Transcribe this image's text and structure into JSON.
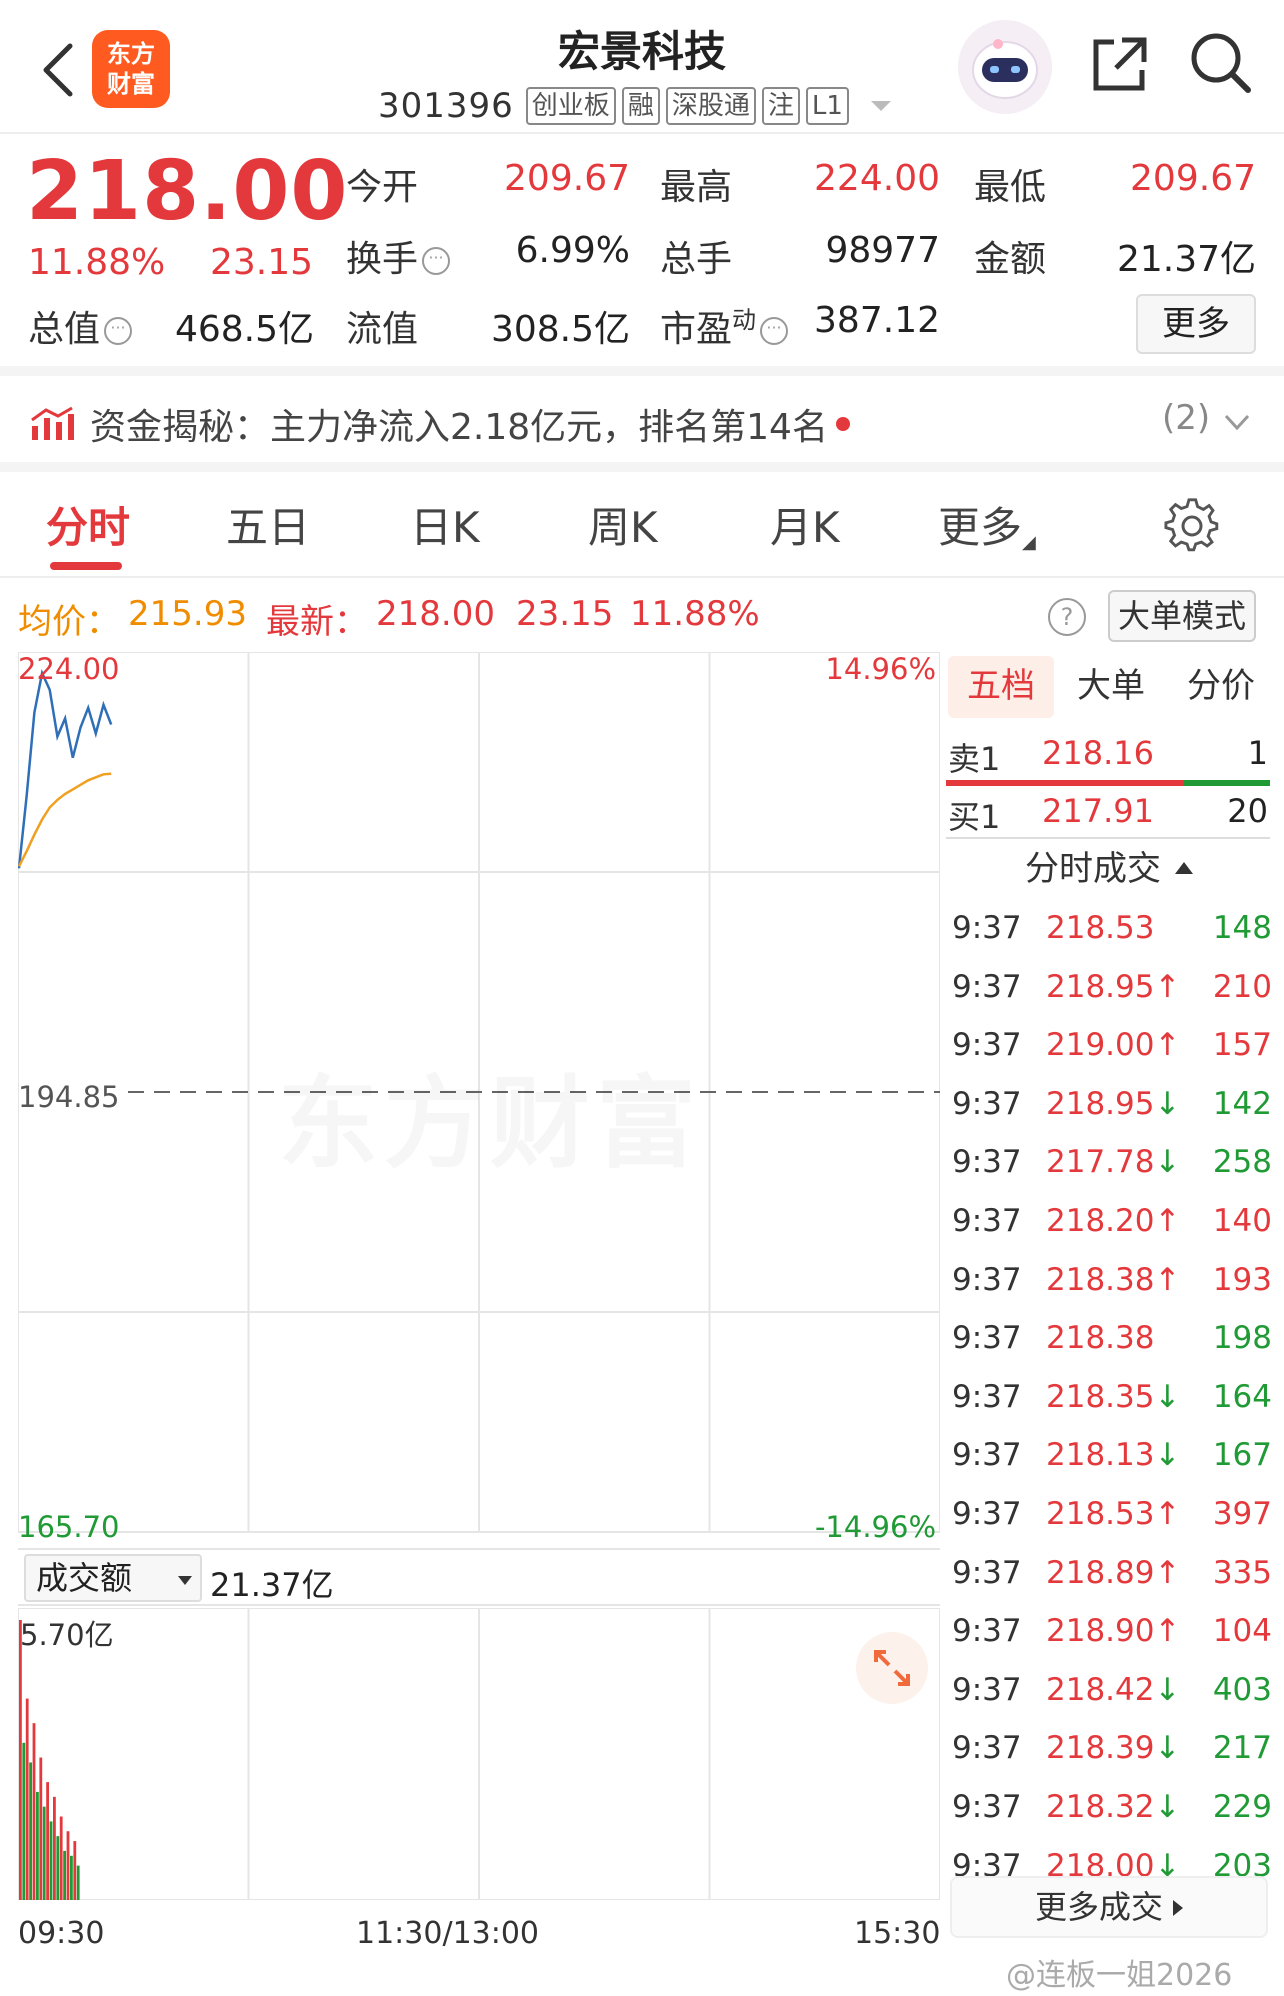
{
  "header": {
    "logo_text": "东方财富",
    "title": "宏景科技",
    "code": "301396",
    "tags": [
      "创业板",
      "融",
      "深股通",
      "注",
      "L1"
    ]
  },
  "quote": {
    "price": "218.00",
    "change_pct": "11.88%",
    "change": "23.15",
    "fields": [
      {
        "label": "今开",
        "value": "209.67",
        "color": "red"
      },
      {
        "label": "最高",
        "value": "224.00",
        "color": "red"
      },
      {
        "label": "最低",
        "value": "209.67",
        "color": "red"
      },
      {
        "label": "换手",
        "value": "6.99%",
        "color": "dark"
      },
      {
        "label": "总手",
        "value": "98977",
        "color": "dark"
      },
      {
        "label": "金额",
        "value": "21.37亿",
        "color": "dark"
      },
      {
        "label": "总值",
        "value": "468.5亿",
        "color": "dark"
      },
      {
        "label": "流值",
        "value": "308.5亿",
        "color": "dark"
      },
      {
        "label": "市盈",
        "label_sup": "动",
        "value": "387.12",
        "color": "dark"
      }
    ],
    "more_label": "更多"
  },
  "capital_flow": {
    "text": "资金揭秘：主力净流入2.18亿元，排名第14名",
    "count": "(2)"
  },
  "tabs": [
    "分时",
    "五日",
    "日K",
    "周K",
    "月K",
    "更多"
  ],
  "active_tab": 0,
  "avg_line": {
    "avg_label": "均价：",
    "avg_value": "215.93",
    "latest_label": "最新：",
    "latest_price": "218.00",
    "latest_change": "23.15",
    "latest_pct": "11.88%",
    "help_label": "?",
    "big_order_mode": "大单模式"
  },
  "chart_data": {
    "type": "line",
    "y_max": "224.00",
    "y_mid": "194.85",
    "y_min": "165.70",
    "pct_max": "14.96%",
    "pct_min": "-14.96%",
    "ylim": [
      165.7,
      224.0
    ],
    "prev_close": 194.85,
    "x_ticks": [
      "09:30",
      "11:30/13:00",
      "15:30"
    ],
    "series": [
      {
        "color": "#2f6fb8",
        "values": [
          209.67,
          214.5,
          220.0,
          222.6,
          221.5,
          218.4,
          219.6,
          217.0,
          219.0,
          220.3,
          218.6,
          220.5,
          219.2
        ]
      },
      {
        "color": "#f0a020",
        "values": [
          209.8,
          210.8,
          211.9,
          212.9,
          213.7,
          214.2,
          214.6,
          214.9,
          215.2,
          215.5,
          215.7,
          215.9,
          215.93
        ]
      }
    ],
    "total_points": 240,
    "volume": {
      "label": "成交额",
      "total": "21.37亿",
      "max_label": "5.70亿",
      "max": 5.7,
      "values": [
        5.7,
        3.2,
        4.1,
        2.8,
        3.6,
        2.2,
        2.9,
        1.9,
        2.4,
        1.6,
        2.1,
        1.3,
        1.7,
        1.0,
        1.4,
        0.9,
        1.2,
        0.7
      ],
      "colors": [
        "red",
        "green",
        "red",
        "green",
        "red",
        "green",
        "red",
        "green",
        "red",
        "green",
        "red",
        "green",
        "red",
        "green",
        "red",
        "green",
        "red",
        "green"
      ]
    }
  },
  "order_book": {
    "tabs": [
      "五档",
      "大单",
      "分价"
    ],
    "sell": {
      "label": "卖1",
      "price": "218.16",
      "volume": "1"
    },
    "buy": {
      "label": "买1",
      "price": "217.91",
      "volume": "20"
    },
    "trades_title": "分时成交",
    "trades": [
      {
        "time": "9:37",
        "price": "218.53",
        "arrow": "",
        "vol": "148",
        "vol_color": "green"
      },
      {
        "time": "9:37",
        "price": "218.95",
        "arrow": "↑",
        "vol": "210",
        "vol_color": "red"
      },
      {
        "time": "9:37",
        "price": "219.00",
        "arrow": "↑",
        "vol": "157",
        "vol_color": "red"
      },
      {
        "time": "9:37",
        "price": "218.95",
        "arrow": "↓",
        "vol": "142",
        "vol_color": "green"
      },
      {
        "time": "9:37",
        "price": "217.78",
        "arrow": "↓",
        "vol": "258",
        "vol_color": "green"
      },
      {
        "time": "9:37",
        "price": "218.20",
        "arrow": "↑",
        "vol": "140",
        "vol_color": "red"
      },
      {
        "time": "9:37",
        "price": "218.38",
        "arrow": "↑",
        "vol": "193",
        "vol_color": "red"
      },
      {
        "time": "9:37",
        "price": "218.38",
        "arrow": "",
        "vol": "198",
        "vol_color": "green"
      },
      {
        "time": "9:37",
        "price": "218.35",
        "arrow": "↓",
        "vol": "164",
        "vol_color": "green"
      },
      {
        "time": "9:37",
        "price": "218.13",
        "arrow": "↓",
        "vol": "167",
        "vol_color": "green"
      },
      {
        "time": "9:37",
        "price": "218.53",
        "arrow": "↑",
        "vol": "397",
        "vol_color": "red"
      },
      {
        "time": "9:37",
        "price": "218.89",
        "arrow": "↑",
        "vol": "335",
        "vol_color": "red"
      },
      {
        "time": "9:37",
        "price": "218.90",
        "arrow": "↑",
        "vol": "104",
        "vol_color": "red"
      },
      {
        "time": "9:37",
        "price": "218.42",
        "arrow": "↓",
        "vol": "403",
        "vol_color": "green"
      },
      {
        "time": "9:37",
        "price": "218.39",
        "arrow": "↓",
        "vol": "217",
        "vol_color": "green"
      },
      {
        "time": "9:37",
        "price": "218.32",
        "arrow": "↓",
        "vol": "229",
        "vol_color": "green"
      },
      {
        "time": "9:37",
        "price": "218.00",
        "arrow": "↓",
        "vol": "203",
        "vol_color": "green"
      }
    ],
    "more_trades": "更多成交"
  },
  "watermark": {
    "center": "东方财富",
    "bottom": "@连板一姐2026"
  }
}
